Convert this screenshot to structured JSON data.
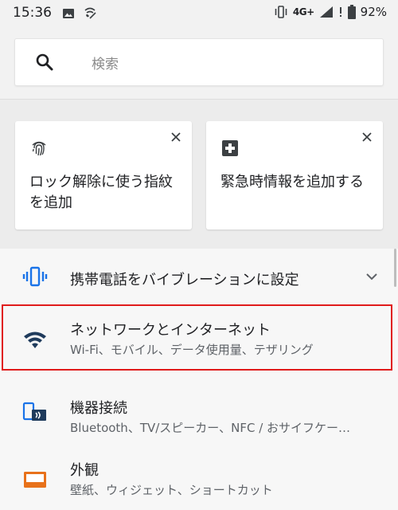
{
  "status_bar": {
    "time": "15:36",
    "network": "4G+",
    "battery": "92%"
  },
  "search": {
    "placeholder": "検索"
  },
  "suggestions": [
    {
      "title": "ロック解除に使う指紋を追加",
      "icon": "fingerprint-icon"
    },
    {
      "title": "緊急時情報を追加する",
      "icon": "medical-plus-icon"
    }
  ],
  "settings": {
    "vibrate": {
      "title": "携帯電話をバイブレーションに設定",
      "icon": "vibrate-icon"
    },
    "network": {
      "title": "ネットワークとインターネット",
      "subtitle": "Wi-Fi、モバイル、データ使用量、テザリング",
      "icon": "wifi-icon"
    },
    "connected_devices": {
      "title": "機器接続",
      "subtitle": "Bluetooth、TV/スピーカー、NFC / おサイフケー…",
      "icon": "devices-icon"
    },
    "display": {
      "title": "外観",
      "subtitle": "壁紙、ウィジェット、ショートカット",
      "icon": "display-icon"
    }
  },
  "colors": {
    "accent_blue": "#1a73e8",
    "wifi_icon": "#1f3b5c",
    "display_icon": "#e8711a",
    "highlight": "#e01b1b"
  }
}
